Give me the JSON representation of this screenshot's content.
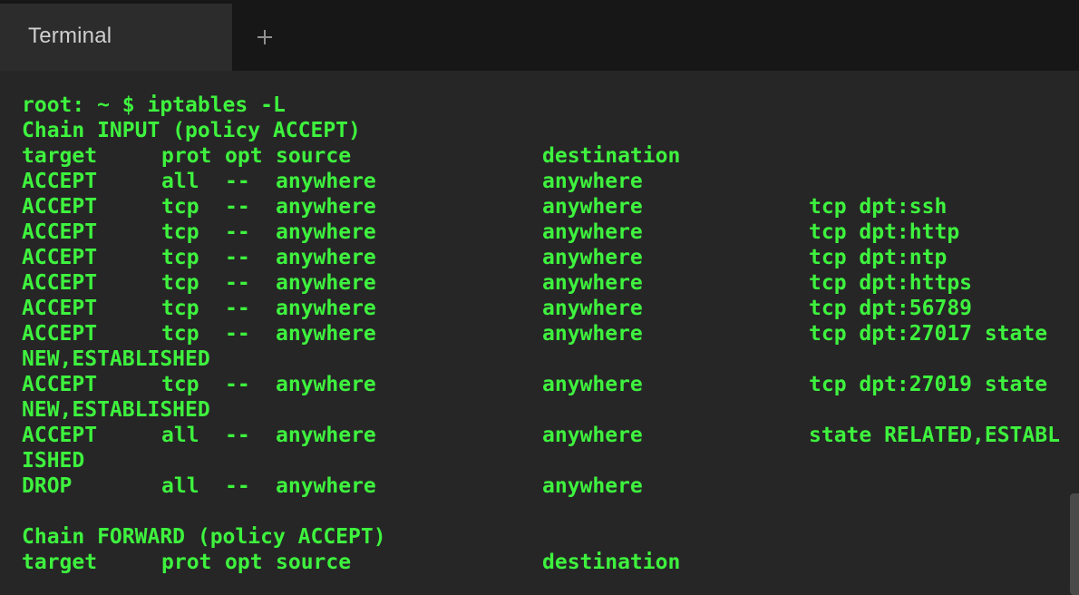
{
  "tab": {
    "label": "Terminal"
  },
  "new_tab": {
    "icon": "plus-icon",
    "glyph": "+"
  },
  "colors": {
    "text": "#3ef23e",
    "background": "#262626",
    "tabbar": "#171717",
    "active_tab": "#2c2c2c"
  },
  "prompt": "root: ~ $ iptables -L",
  "input_chain": {
    "header": "Chain INPUT (policy ACCEPT)",
    "columns": {
      "target": "target",
      "prot": "prot",
      "opt": "opt",
      "source": "source",
      "destination": "destination"
    },
    "rules": [
      {
        "target": "ACCEPT",
        "prot": "all",
        "opt": "--",
        "source": "anywhere",
        "destination": "anywhere",
        "extra": ""
      },
      {
        "target": "ACCEPT",
        "prot": "tcp",
        "opt": "--",
        "source": "anywhere",
        "destination": "anywhere",
        "extra": "tcp dpt:ssh"
      },
      {
        "target": "ACCEPT",
        "prot": "tcp",
        "opt": "--",
        "source": "anywhere",
        "destination": "anywhere",
        "extra": "tcp dpt:http"
      },
      {
        "target": "ACCEPT",
        "prot": "tcp",
        "opt": "--",
        "source": "anywhere",
        "destination": "anywhere",
        "extra": "tcp dpt:ntp"
      },
      {
        "target": "ACCEPT",
        "prot": "tcp",
        "opt": "--",
        "source": "anywhere",
        "destination": "anywhere",
        "extra": "tcp dpt:https"
      },
      {
        "target": "ACCEPT",
        "prot": "tcp",
        "opt": "--",
        "source": "anywhere",
        "destination": "anywhere",
        "extra": "tcp dpt:56789"
      },
      {
        "target": "ACCEPT",
        "prot": "tcp",
        "opt": "--",
        "source": "anywhere",
        "destination": "anywhere",
        "extra": "tcp dpt:27017 state",
        "wrap": "NEW,ESTABLISHED"
      },
      {
        "target": "ACCEPT",
        "prot": "tcp",
        "opt": "--",
        "source": "anywhere",
        "destination": "anywhere",
        "extra": "tcp dpt:27019 state",
        "wrap": "NEW,ESTABLISHED"
      },
      {
        "target": "ACCEPT",
        "prot": "all",
        "opt": "--",
        "source": "anywhere",
        "destination": "anywhere",
        "extra": "state RELATED,ESTABL",
        "wrap": "ISHED"
      },
      {
        "target": "DROP",
        "prot": "all",
        "opt": "--",
        "source": "anywhere",
        "destination": "anywhere",
        "extra": ""
      }
    ]
  },
  "forward_chain": {
    "header": "Chain FORWARD (policy ACCEPT)",
    "columns": {
      "target": "target",
      "prot": "prot",
      "opt": "opt",
      "source": "source",
      "destination": "destination"
    }
  }
}
